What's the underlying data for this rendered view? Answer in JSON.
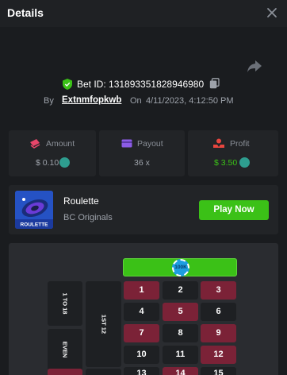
{
  "header": {
    "title": "Details"
  },
  "bet": {
    "id_label": "Bet ID: 131893351828946980",
    "by": "By",
    "username": "Extnmfopkwb",
    "on": "On",
    "date": "4/11/2023, 4:12:50 PM"
  },
  "stats": {
    "amount": {
      "label": "Amount",
      "value": "$ 0.10"
    },
    "payout": {
      "label": "Payout",
      "value": "36 x"
    },
    "profit": {
      "label": "Profit",
      "value": "$ 3.50"
    }
  },
  "game": {
    "thumb_label": "ROULETTE",
    "name": "Roulette",
    "provider": "BC Originals",
    "play_label": "Play Now"
  },
  "table": {
    "chip_label": "100K",
    "side_low": "1 TO 18",
    "side_even": "EVEN",
    "dozen": "1ST 12",
    "numbers": [
      "1",
      "2",
      "3",
      "4",
      "5",
      "6",
      "7",
      "8",
      "9",
      "10",
      "11",
      "12",
      "13",
      "14",
      "15"
    ]
  },
  "colors": {
    "accent_green": "#3bc117",
    "red_cell": "#7b2237",
    "black_cell": "#1e2023",
    "profit_green": "#3bc117"
  }
}
